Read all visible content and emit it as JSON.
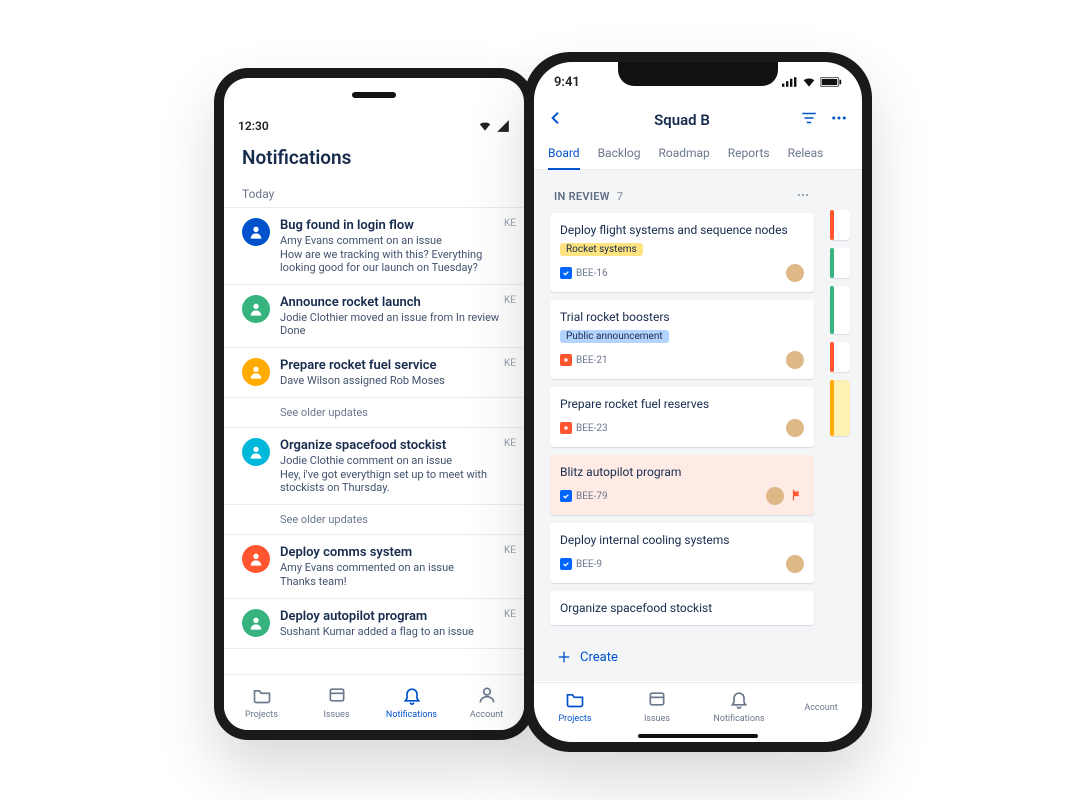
{
  "android": {
    "status_time": "12:30",
    "title": "Notifications",
    "section": "Today",
    "older": "See older updates",
    "tag": "KE",
    "items": [
      {
        "title": "Bug found in login flow",
        "meta": "Amy Evans comment on an issue",
        "text": "How are we tracking with this? Everything looking good for our launch on Tuesday?",
        "color": "g6"
      },
      {
        "title": "Announce rocket launch",
        "meta": "Jodie Clothier moved an issue from In review Done",
        "text": "",
        "color": "g2"
      },
      {
        "title": "Prepare rocket fuel service",
        "meta": "Dave Wilson assigned Rob Moses",
        "text": "",
        "color": "g1",
        "older": true
      },
      {
        "title": "Organize spacefood stockist",
        "meta": "Jodie Clothie comment on an issue",
        "text": "Hey, i've got everythign set up to meet with stockists on Thursday.",
        "color": "g3",
        "older": true
      },
      {
        "title": "Deploy comms system",
        "meta": "Amy Evans commented on an issue",
        "text": "Thanks team!",
        "color": "g5"
      },
      {
        "title": "Deploy autopilot program",
        "meta": "Sushant Kumar added a flag to an issue",
        "text": "",
        "color": "g2"
      }
    ],
    "tabs": [
      "Projects",
      "Issues",
      "Notifications",
      "Account"
    ],
    "active_tab": 2
  },
  "ios": {
    "status_time": "9:41",
    "title": "Squad B",
    "segtabs": [
      "Board",
      "Backlog",
      "Roadmap",
      "Reports",
      "Releas"
    ],
    "active_seg": 0,
    "column": {
      "name": "IN REVIEW",
      "count": "7",
      "cards": [
        {
          "title": "Deploy flight systems and sequence nodes",
          "label": "Rocket systems",
          "label_color": "yellow",
          "type": "task",
          "key": "BEE-16",
          "assignee": "av-img"
        },
        {
          "title": "Trial rocket boosters",
          "label": "Public announcement",
          "label_color": "blue",
          "type": "bug",
          "key": "BEE-21",
          "assignee": "av-img"
        },
        {
          "title": "Prepare rocket fuel reserves",
          "type": "bug",
          "key": "BEE-23",
          "assignee": "av-img"
        },
        {
          "title": "Blitz autopilot program",
          "type": "task",
          "key": "BEE-79",
          "assignee": "av-img",
          "flagged": true
        },
        {
          "title": "Deploy internal cooling systems",
          "type": "task",
          "key": "BEE-9",
          "assignee": "av-img"
        },
        {
          "title": "Organize spacefood stockist",
          "type": "task",
          "key": "",
          "assignee": ""
        }
      ]
    },
    "create": "Create",
    "tabs": [
      "Projects",
      "Issues",
      "Notifications",
      "Account"
    ],
    "active_tab": 0,
    "page_dots": 4,
    "page_active": 2
  }
}
